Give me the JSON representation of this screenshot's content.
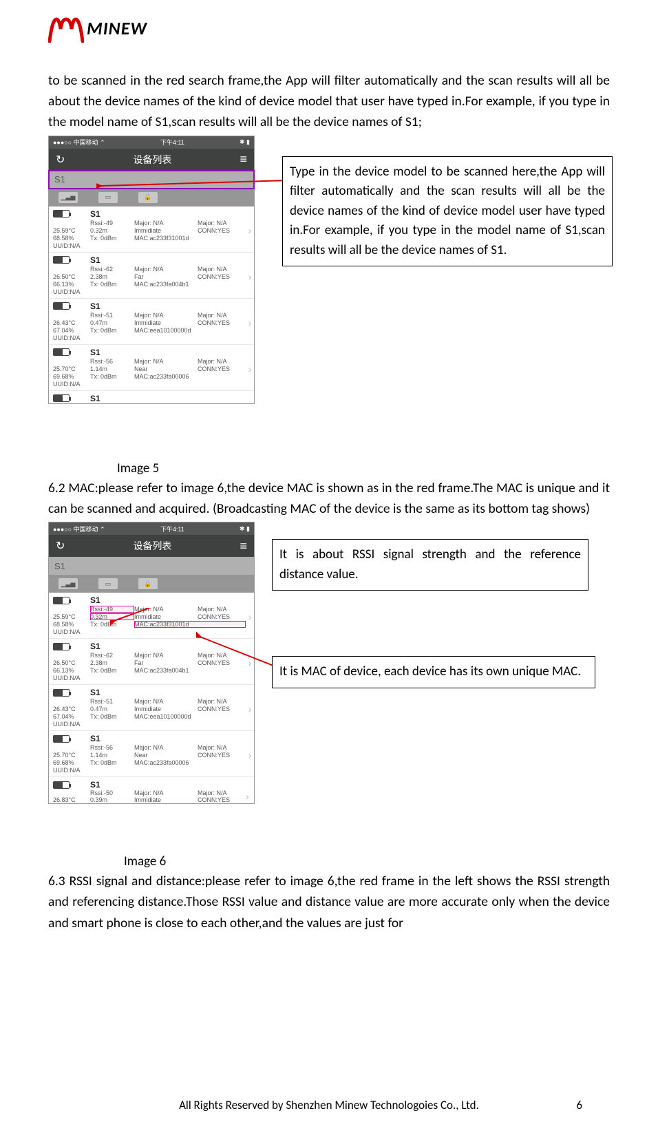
{
  "logo": {
    "text": "MINEW"
  },
  "para1": "to be scanned in the red search frame,the App will filter automatically and the scan results will all be about the device names of the kind of device model that user have typed in.For example, if you type in the model name of S1,scan results will all be the device names of S1;",
  "para2": "6.2 MAC:please refer to image 6,the device MAC is shown as in the red frame.The MAC is unique and it can be scanned and acquired. (Broadcasting MAC of the device is the same as its bottom tag shows)",
  "para3": "6.3 RSSI signal and distance:please refer to image 6,the red frame in the left shows the RSSI strength and referencing distance.Those RSSI value and distance value are more accurate only when the device and smart phone is close to each other,and the values are just for",
  "image5": {
    "caption": "Image 5",
    "callout": "Type in the device model to be scanned here,the App will filter automatically and the scan results will all be the device names of the kind of device model user have typed in.For example, if you type in the model name of S1,scan results will all be the device names of S1.",
    "status": {
      "left": "●●●○○ 中国移动 ⌃",
      "center": "下午4:11",
      "right": "✱ ▮"
    },
    "header_title": "设备列表",
    "search_text": "S1",
    "devices": [
      {
        "name": "S1",
        "rssi": "Rssi:-49",
        "maj1": "Major: N/A",
        "maj2": "Major: N/A",
        "temp": "25.59°C",
        "dist": "0.32m",
        "prox": "Immidiate",
        "conn": "CONN:YES",
        "pct": "68.58%",
        "tx": "Tx: 0dBm",
        "mac": "MAC:ac233f31001d",
        "uuid": "UUID:N/A"
      },
      {
        "name": "S1",
        "rssi": "Rssi:-62",
        "maj1": "Major: N/A",
        "maj2": "Major: N/A",
        "temp": "26.50°C",
        "dist": "2.38m",
        "prox": "Far",
        "conn": "CONN:YES",
        "pct": "66.13%",
        "tx": "Tx: 0dBm",
        "mac": "MAC:ac233fa004b1",
        "uuid": "UUID:N/A"
      },
      {
        "name": "S1",
        "rssi": "Rssi:-51",
        "maj1": "Major: N/A",
        "maj2": "Major: N/A",
        "temp": "26.43°C",
        "dist": "0.47m",
        "prox": "Immidiate",
        "conn": "CONN:YES",
        "pct": "67.04%",
        "tx": "Tx: 0dBm",
        "mac": "MAC:eea10100000d",
        "uuid": "UUID:N/A"
      },
      {
        "name": "S1",
        "rssi": "Rssi:-56",
        "maj1": "Major: N/A",
        "maj2": "Major: N/A",
        "temp": "25.70°C",
        "dist": "1.14m",
        "prox": "Near",
        "conn": "CONN:YES",
        "pct": "69.68%",
        "tx": "Tx: 0dBm",
        "mac": "MAC:ac233fa00006",
        "uuid": "UUID:N/A"
      }
    ],
    "partial": {
      "name": "S1"
    }
  },
  "image6": {
    "caption": "Image 6",
    "callout1": "It is about RSSI signal strength and the reference distance value.",
    "callout2": "It is MAC of device, each device has its own unique MAC.",
    "status": {
      "left": "●●●○○ 中国移动 ⌃",
      "center": "下午4:11",
      "right": "✱ ▮"
    },
    "header_title": "设备列表",
    "search_text": "S1",
    "devices": [
      {
        "name": "S1",
        "rssi": "Rssi:-49",
        "maj1": "Major: N/A",
        "maj2": "Major: N/A",
        "temp": "25.59°C",
        "dist": "0.32m",
        "prox": "Immidiate",
        "conn": "CONN:YES",
        "pct": "68.58%",
        "tx": "Tx: 0dBm",
        "mac": "MAC:ac233f31001d",
        "uuid": "UUID:N/A",
        "hl_rssi": true,
        "hl_mac": true
      },
      {
        "name": "S1",
        "rssi": "Rssi:-62",
        "maj1": "Major: N/A",
        "maj2": "Major: N/A",
        "temp": "26.50°C",
        "dist": "2.38m",
        "prox": "Far",
        "conn": "CONN:YES",
        "pct": "66.13%",
        "tx": "Tx: 0dBm",
        "mac": "MAC:ac233fa004b1",
        "uuid": "UUID:N/A"
      },
      {
        "name": "S1",
        "rssi": "Rssi:-51",
        "maj1": "Major: N/A",
        "maj2": "Major: N/A",
        "temp": "26.43°C",
        "dist": "0.47m",
        "prox": "Immidiate",
        "conn": "CONN:YES",
        "pct": "67.04%",
        "tx": "Tx: 0dBm",
        "mac": "MAC:eea10100000d",
        "uuid": "UUID:N/A"
      },
      {
        "name": "S1",
        "rssi": "Rssi:-56",
        "maj1": "Major: N/A",
        "maj2": "Major: N/A",
        "temp": "25.70°C",
        "dist": "1.14m",
        "prox": "Near",
        "conn": "CONN:YES",
        "pct": "69.68%",
        "tx": "Tx: 0dBm",
        "mac": "MAC:ac233fa00006",
        "uuid": "UUID:N/A"
      }
    ],
    "partial": {
      "name": "S1",
      "rssi": "Rssi:-50",
      "maj1": "Major: N/A",
      "maj2": "Major: N/A",
      "temp": "26.83°C",
      "dist": "0.39m",
      "prox": "Immidiate",
      "conn": "CONN:YES"
    }
  },
  "footer": "All Rights Reserved by Shenzhen Minew Technologoies Co., Ltd.",
  "page_number": "6"
}
